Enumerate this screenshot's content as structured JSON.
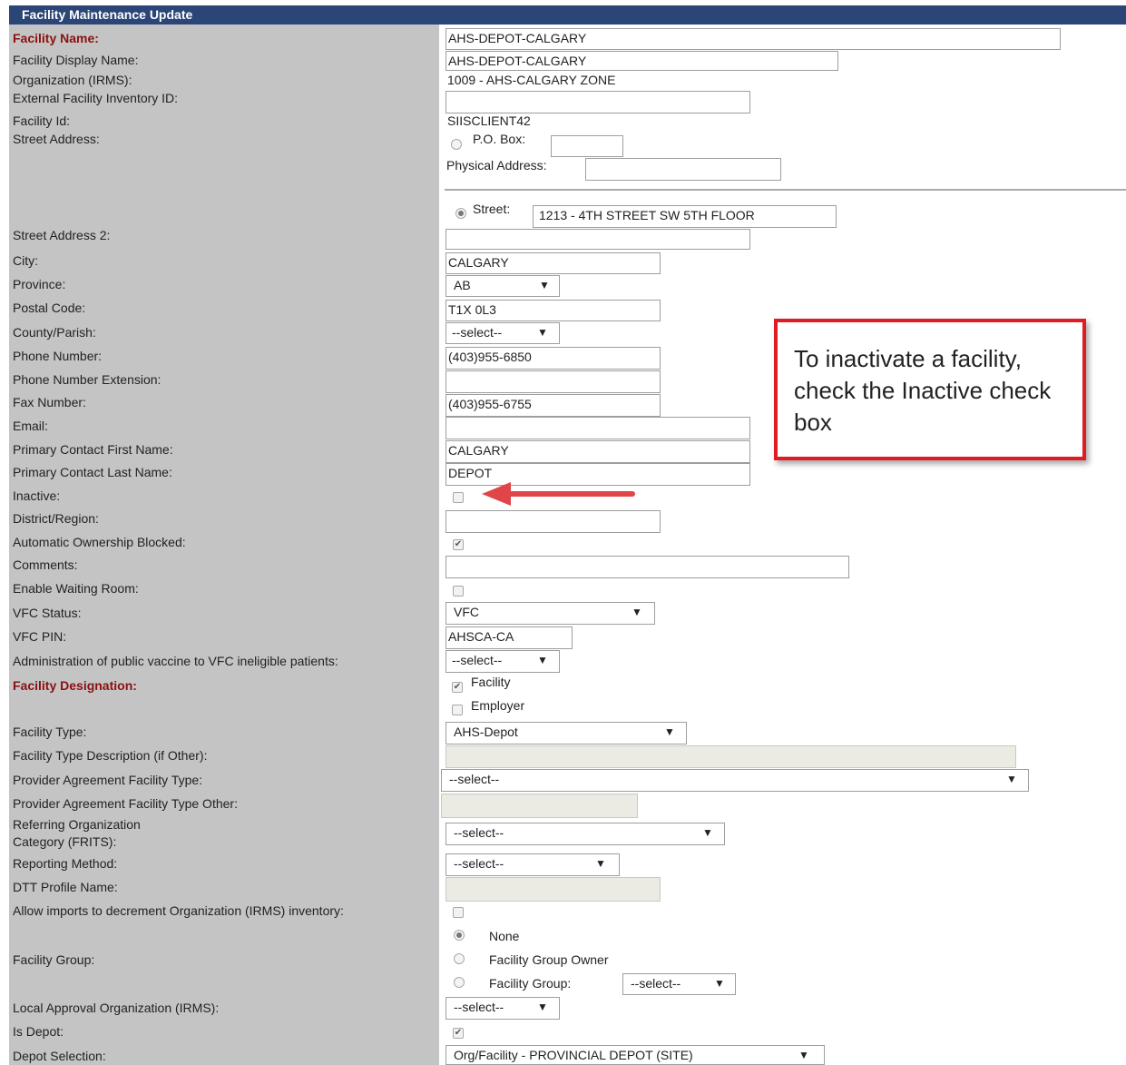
{
  "title": "Facility Maintenance Update",
  "fields": {
    "facility_name": {
      "label": "Facility Name:",
      "value": "AHS-DEPOT-CALGARY"
    },
    "display_name": {
      "label": "Facility Display Name:",
      "value": "AHS-DEPOT-CALGARY"
    },
    "organization": {
      "label": "Organization (IRMS):",
      "value": "1009 - AHS-CALGARY ZONE"
    },
    "external_id": {
      "label": "External Facility Inventory ID:",
      "value": ""
    },
    "facility_id": {
      "label": "Facility Id:",
      "value": "SIISCLIENT42"
    },
    "street_address": {
      "label": "Street Address:",
      "po_box_label": "P.O. Box:",
      "po_box_value": "",
      "physical_label": "Physical Address:",
      "physical_value": "",
      "street_label": "Street:",
      "street_value": "1213 - 4TH STREET SW 5TH FLOOR"
    },
    "street2": {
      "label": "Street Address 2:",
      "value": ""
    },
    "city": {
      "label": "City:",
      "value": "CALGARY"
    },
    "province": {
      "label": "Province:",
      "value": "AB"
    },
    "postal": {
      "label": "Postal Code:",
      "value": "T1X 0L3"
    },
    "county": {
      "label": "County/Parish:",
      "value": "--select--"
    },
    "phone": {
      "label": "Phone Number:",
      "value": "(403)955-6850"
    },
    "phone_ext": {
      "label": "Phone Number Extension:",
      "value": ""
    },
    "fax": {
      "label": "Fax Number:",
      "value": "(403)955-6755"
    },
    "email": {
      "label": "Email:",
      "value": ""
    },
    "contact_first": {
      "label": "Primary Contact First Name:",
      "value": "CALGARY"
    },
    "contact_last": {
      "label": "Primary Contact Last Name:",
      "value": "DEPOT"
    },
    "inactive": {
      "label": "Inactive:",
      "checked": false
    },
    "district": {
      "label": "District/Region:",
      "value": ""
    },
    "auto_ownership": {
      "label": "Automatic Ownership Blocked:",
      "checked": true
    },
    "comments": {
      "label": "Comments:",
      "value": ""
    },
    "waiting_room": {
      "label": "Enable Waiting Room:",
      "checked": false
    },
    "vfc_status": {
      "label": "VFC Status:",
      "value": "VFC"
    },
    "vfc_pin": {
      "label": "VFC PIN:",
      "value": "AHSCA-CA"
    },
    "admin_public": {
      "label": "Administration of public vaccine to VFC ineligible patients:",
      "value": "--select--"
    },
    "designation": {
      "label": "Facility Designation:",
      "facility_label": "Facility",
      "facility_checked": true,
      "employer_label": "Employer",
      "employer_checked": false
    },
    "facility_type": {
      "label": "Facility Type:",
      "value": "AHS-Depot"
    },
    "facility_type_desc": {
      "label": "Facility Type Description (if Other):",
      "value": ""
    },
    "provider_type": {
      "label": "Provider Agreement Facility Type:",
      "value": "--select--"
    },
    "provider_type_other": {
      "label": "Provider Agreement Facility Type Other:",
      "value": ""
    },
    "referring_org": {
      "label_1": "Referring Organization",
      "label_2": " Category (FRITS):",
      "value": "--select--"
    },
    "reporting_method": {
      "label": "Reporting Method:",
      "value": "--select--"
    },
    "dtt_profile": {
      "label": "DTT Profile Name:",
      "value": ""
    },
    "allow_imports": {
      "label": "Allow imports to decrement Organization (IRMS) inventory:",
      "checked": false
    },
    "facility_group": {
      "label": "Facility Group:",
      "opt_none": "None",
      "opt_owner": "Facility Group Owner",
      "opt_group": "Facility Group:",
      "group_select": "--select--",
      "selected": "None"
    },
    "local_approval": {
      "label": "Local Approval Organization (IRMS):",
      "value": "--select--"
    },
    "is_depot": {
      "label": "Is Depot:",
      "checked": true
    },
    "depot_selection": {
      "label": "Depot Selection:",
      "value": "Org/Facility - PROVINCIAL DEPOT (SITE)"
    }
  },
  "callout": {
    "text": "To inactivate a facility, check the Inactive check box"
  },
  "glyphs": {
    "arrow": "▼",
    "check": "✔"
  }
}
